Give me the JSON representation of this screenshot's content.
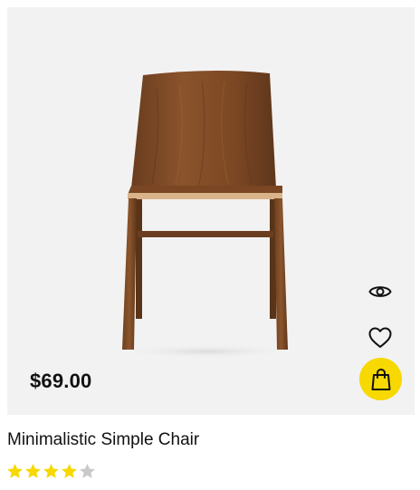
{
  "product": {
    "name": "Minimalistic Simple Chair",
    "price": "$69.00",
    "rating": 4,
    "rating_max": 5,
    "image_icon": "wooden-chair"
  },
  "actions": {
    "quick_view_icon": "eye-icon",
    "wishlist_icon": "heart-icon",
    "cart_icon": "shopping-bag-icon"
  },
  "colors": {
    "accent": "#f7d800",
    "star_filled": "#f7d800",
    "star_empty": "#c9c9c9",
    "media_background": "#f2f2f2"
  }
}
